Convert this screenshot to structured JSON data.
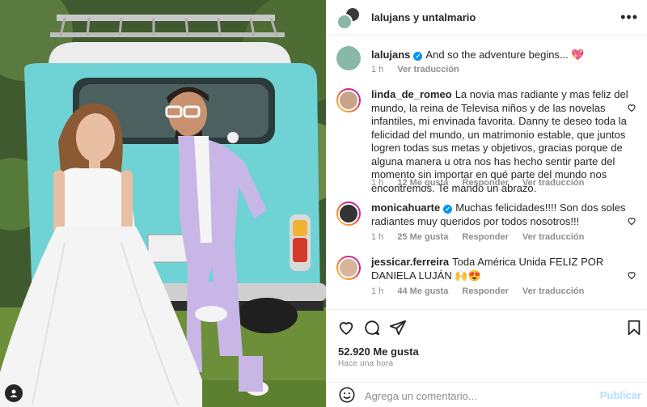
{
  "header": {
    "title": "lalujans y untalmario",
    "more_glyph": "•••"
  },
  "caption": {
    "username": "lalujans",
    "text": "And so the adventure begins... 💖",
    "time": "1 h",
    "translate": "Ver traducción"
  },
  "comments": [
    {
      "username": "linda_de_romeo",
      "text": "La novia mas radiante y mas feliz del mundo, la reina de Televisa niños y de las novelas infantiles, mi envinada favorita. Danny te deseo toda la felicidad del mundo, un matrimonio estable, que juntos logren todas sus metas y objetivos, gracias porque de alguna manera u otra nos has hecho sentir parte del momento sin importar en qué parte del mundo nos encontremos. Te mando un abrazo.",
      "time": "1 h",
      "likes": "12 Me gusta",
      "reply": "Responder",
      "translate": "Ver traducción"
    },
    {
      "username": "monicahuarte",
      "text": "Muchas felicidades!!!! Son dos soles radiantes muy queridos por todos nosotros!!!",
      "time": "1 h",
      "likes": "25 Me gusta",
      "reply": "Responder",
      "translate": "Ver traducción"
    },
    {
      "username": "jessicar.ferreira",
      "text": "Toda América Unida FELIZ POR DANIELA LUJÁN 🙌😍",
      "time": "1 h",
      "likes": "44 Me gusta",
      "reply": "Responder",
      "translate": "Ver traducción"
    }
  ],
  "post": {
    "likes": "52.920 Me gusta",
    "time": "Hace una hora"
  },
  "add_comment": {
    "placeholder": "Agrega un comentario...",
    "post_label": "Publicar"
  },
  "icons": [
    "heart-icon",
    "comment-icon",
    "share-icon",
    "bookmark-icon",
    "emoji-icon",
    "more-icon",
    "verified-icon",
    "user-tag-icon"
  ],
  "colors": {
    "verified": "#0095f6",
    "post_disabled": "#b2dffc",
    "secondary_text": "#8e8e8e",
    "van_body": "#6fd3d6"
  }
}
